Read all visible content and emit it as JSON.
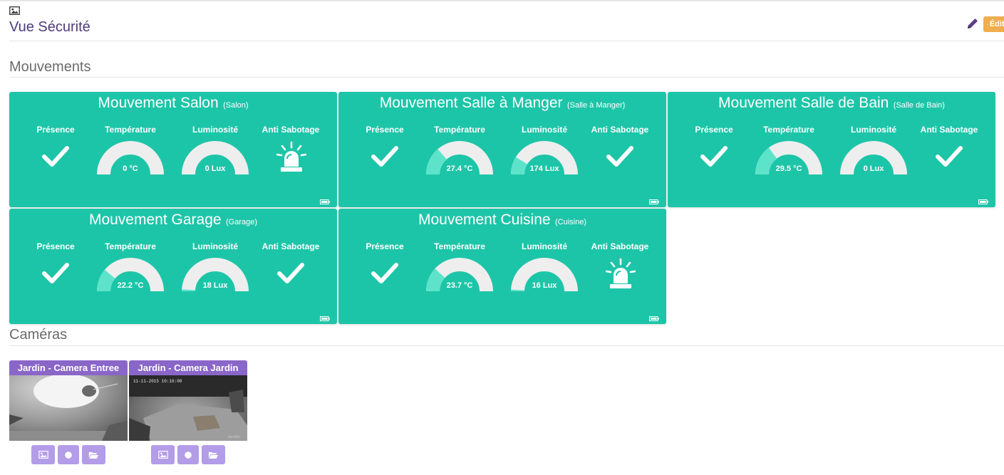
{
  "view": {
    "title": "Vue Sécurité",
    "icon": "image-icon",
    "edit_label": "Éditer"
  },
  "sections": {
    "movements": "Mouvements",
    "cameras": "Caméras"
  },
  "labels": {
    "presence": "Présence",
    "temperature": "Température",
    "luminosity": "Luminosité",
    "anti_sabotage": "Anti Sabotage"
  },
  "colors": {
    "card_bg": "#1dc5a8",
    "gauge_track": "#eeeeee",
    "gauge_fill": "#5ee3cb",
    "title_purple": "#4e3b7a",
    "camera_header": "#8a66c8",
    "camera_button": "#b39ce8",
    "edit_orange": "#f0ad4e"
  },
  "sensors": [
    {
      "name": "Mouvement Salon",
      "room": "(Salon)",
      "presence_icon": "check-icon",
      "temp": {
        "value": 0,
        "text": "0 °C",
        "min": 0,
        "max": 100
      },
      "lux": {
        "value": 0,
        "text": "0 Lux",
        "min": 0,
        "max": 1000
      },
      "sabotage_icon": "siren-icon"
    },
    {
      "name": "Mouvement Salle à Manger",
      "room": "(Salle à Manger)",
      "presence_icon": "check-icon",
      "temp": {
        "value": 27.4,
        "text": "27.4 °C",
        "min": 0,
        "max": 100
      },
      "lux": {
        "value": 174,
        "text": "174 Lux",
        "min": 0,
        "max": 1000
      },
      "sabotage_icon": "check-icon"
    },
    {
      "name": "Mouvement Salle de Bain",
      "room": "(Salle de Bain)",
      "presence_icon": "check-icon",
      "temp": {
        "value": 29.5,
        "text": "29.5 °C",
        "min": 0,
        "max": 100
      },
      "lux": {
        "value": 0,
        "text": "0 Lux",
        "min": 0,
        "max": 1000
      },
      "sabotage_icon": "check-icon"
    },
    {
      "name": "Mouvement Garage",
      "room": "(Garage)",
      "presence_icon": "check-icon",
      "temp": {
        "value": 22.2,
        "text": "22.2 °C",
        "min": 0,
        "max": 100
      },
      "lux": {
        "value": 18,
        "text": "18 Lux",
        "min": 0,
        "max": 1000
      },
      "sabotage_icon": "check-icon"
    },
    {
      "name": "Mouvement Cuisine",
      "room": "(Cuisine)",
      "presence_icon": "check-icon",
      "temp": {
        "value": 23.7,
        "text": "23.7 °C",
        "min": 0,
        "max": 100
      },
      "lux": {
        "value": 16,
        "text": "16 Lux",
        "min": 0,
        "max": 1000
      },
      "sabotage_icon": "siren-icon"
    }
  ],
  "cameras": [
    {
      "title": "Jardin - Camera Entree",
      "overlay": "",
      "buttons": [
        "snapshot-icon",
        "record-icon",
        "folder-icon"
      ]
    },
    {
      "title": "Jardin - Camera Jardin",
      "overlay": "11-11-2015 10:16:00",
      "buttons": [
        "snapshot-icon",
        "record-icon",
        "folder-icon"
      ]
    }
  ]
}
